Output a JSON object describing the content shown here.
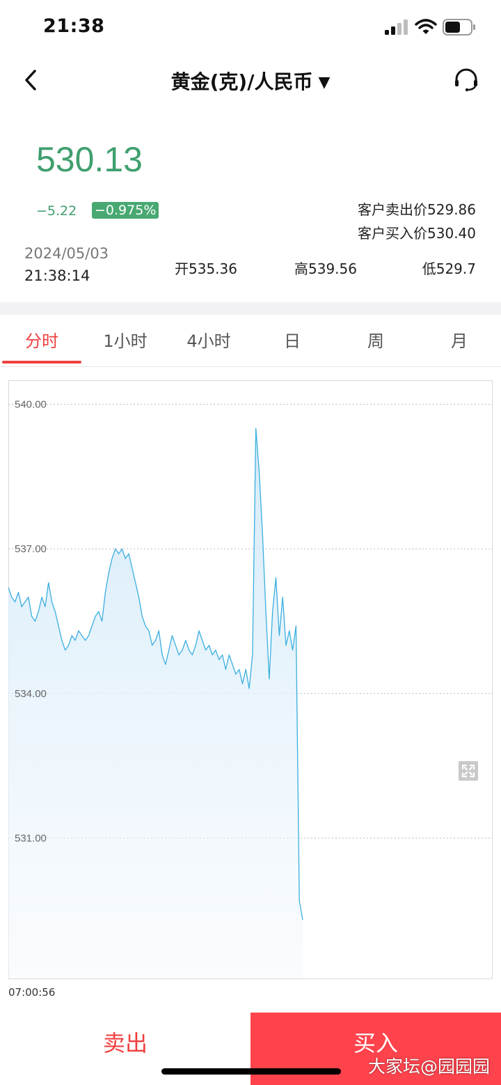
{
  "status_bar": {
    "time": "21:38",
    "battery_level": 0.6
  },
  "nav": {
    "title": "黄金(克)/人民币",
    "caret": "▼",
    "icons": [
      "back-chevron-icon",
      "headset-icon"
    ]
  },
  "quote": {
    "price": "530.13",
    "change": "−5.22",
    "change_pct": "−0.975%",
    "sell_price": "客户卖出价529.86",
    "buy_price": "客户买入价530.40",
    "date": "2024/05/03",
    "time": "21:38:14",
    "open": "开535.36",
    "high": "高539.56",
    "low": "低529.7"
  },
  "tabs": [
    {
      "label": "分时",
      "active": true
    },
    {
      "label": "1小时",
      "active": false
    },
    {
      "label": "4小时",
      "active": false
    },
    {
      "label": "日",
      "active": false
    },
    {
      "label": "周",
      "active": false
    },
    {
      "label": "月",
      "active": false
    }
  ],
  "colors": {
    "up_down_green": "#3f9f6e",
    "accent_red": "#f04040",
    "buy_red": "#fe434c",
    "line_blue": "#3aaee0"
  },
  "chart_data": {
    "type": "area",
    "y_ticks": [
      "540.00",
      "537.00",
      "534.00",
      "531.00"
    ],
    "ylim": [
      528.1,
      540.5
    ],
    "start_time": "07:00:56",
    "grid": true,
    "series": [
      {
        "values": [
          536.2,
          536.0,
          535.9,
          536.1,
          535.8,
          535.9,
          536.0,
          535.6,
          535.5,
          535.7,
          536.0,
          535.8,
          536.3,
          535.9,
          535.7,
          535.4,
          535.1,
          534.9,
          535.0,
          535.2,
          535.1,
          535.3,
          535.2,
          535.1,
          535.2,
          535.4,
          535.6,
          535.7,
          535.5,
          536.1,
          536.5,
          536.8,
          537.0,
          536.9,
          537.0,
          536.8,
          536.9,
          536.6,
          536.3,
          536.0,
          535.6,
          535.4,
          535.3,
          535.0,
          535.1,
          535.3,
          534.8,
          534.6,
          534.9,
          535.2,
          535.0,
          534.8,
          534.9,
          535.1,
          534.9,
          534.8,
          535.0,
          535.3,
          535.1,
          534.9,
          535.0,
          534.8,
          534.9,
          534.7,
          534.8,
          534.5,
          534.8,
          534.6,
          534.4,
          534.5,
          534.2,
          534.5,
          534.1,
          534.8,
          539.5,
          538.6,
          537.3,
          535.7,
          534.3,
          535.7,
          536.4,
          535.2,
          536.0,
          535.0,
          535.3,
          534.9,
          535.4,
          529.7,
          529.3
        ]
      }
    ]
  },
  "actions": {
    "sell": "卖出",
    "buy": "买入"
  },
  "watermark": "大家坛@园园园"
}
